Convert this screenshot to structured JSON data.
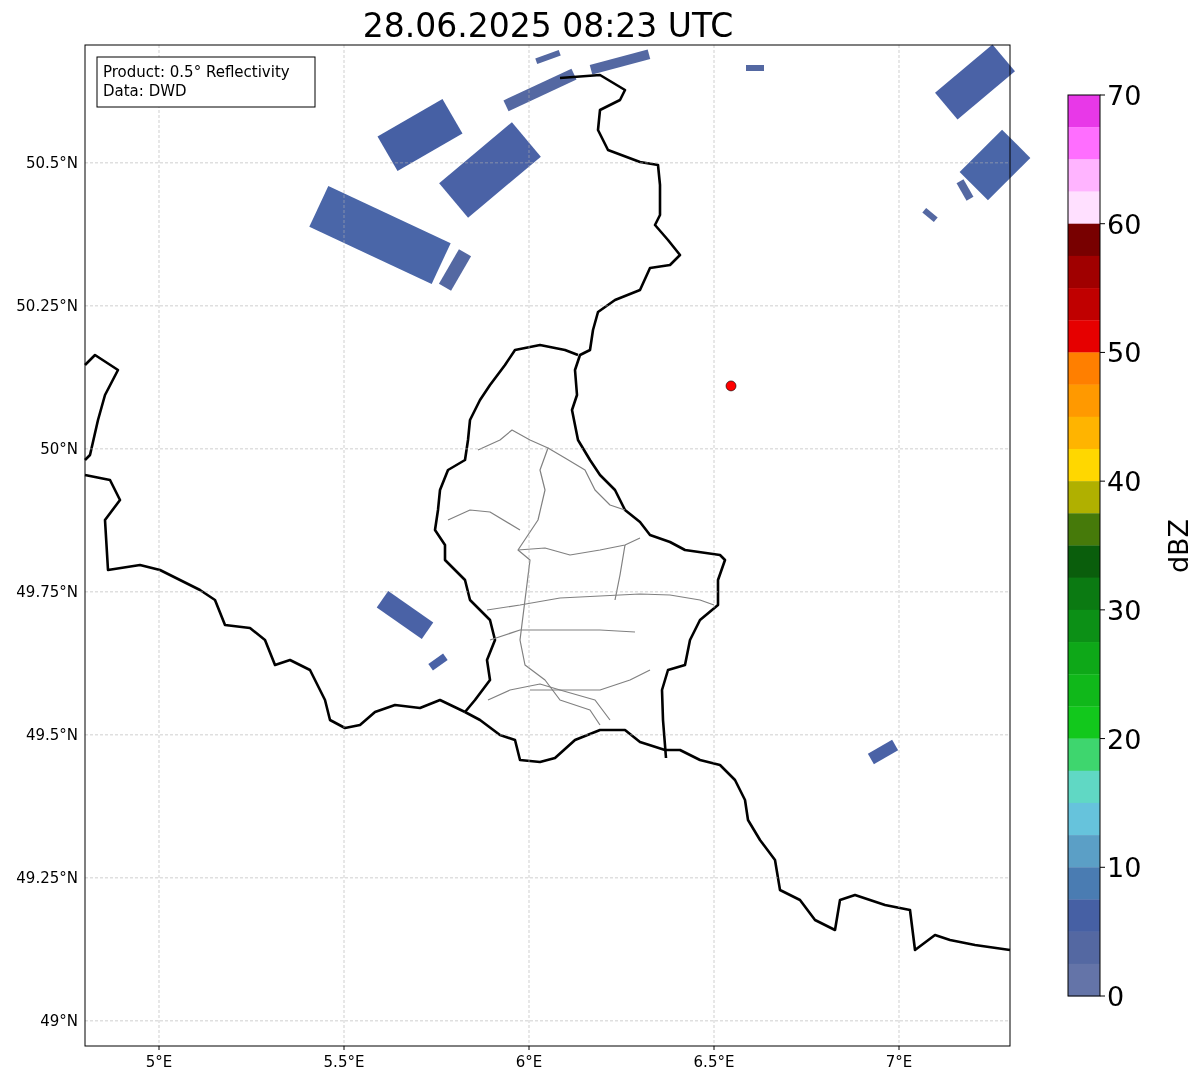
{
  "map": {
    "info_box": [
      "Product: 0.5° Reflectivity",
      "Data: DWD"
    ],
    "chart_data": {
      "type": "scatter",
      "title": "28.06.2025 08:23 UTC",
      "x": [
        6.546
      ],
      "series": [
        {
          "color": "#ff0000",
          "values": [
            50.11
          ]
        }
      ],
      "grid": true,
      "xlim": [
        4.8,
        7.3
      ],
      "ylim": [
        48.956,
        50.706
      ],
      "xticks": [
        {
          "value": 5,
          "label": "5°E"
        },
        {
          "value": 5.5,
          "label": "5.5°E"
        },
        {
          "value": 6,
          "label": "6°E"
        },
        {
          "value": 6.5,
          "label": "6.5°E"
        },
        {
          "value": 7,
          "label": "7°E"
        }
      ],
      "yticks": [
        {
          "value": 49,
          "label": "49°N"
        },
        {
          "value": 49.25,
          "label": "49.25°N"
        },
        {
          "value": 49.5,
          "label": "49.5°N"
        },
        {
          "value": 49.75,
          "label": "49.75°N"
        },
        {
          "value": 50,
          "label": "50°N"
        },
        {
          "value": 50.25,
          "label": "50.25°N"
        },
        {
          "value": 50.5,
          "label": "50.5°N"
        }
      ]
    }
  },
  "colorbar": {
    "label": "dBZ",
    "ticks": [
      "70",
      "60",
      "50",
      "40",
      "30",
      "20",
      "10",
      "0"
    ],
    "bands": [
      {
        "color": "#e838e8"
      },
      {
        "color": "#ff6eff"
      },
      {
        "color": "#ffb4ff"
      },
      {
        "color": "#ffe0ff"
      },
      {
        "color": "#780000"
      },
      {
        "color": "#a00000"
      },
      {
        "color": "#c00000"
      },
      {
        "color": "#e60000"
      },
      {
        "color": "#ff7f00"
      },
      {
        "color": "#ff9900"
      },
      {
        "color": "#ffb400"
      },
      {
        "color": "#ffd700"
      },
      {
        "color": "#b0b000"
      },
      {
        "color": "#467a0a"
      },
      {
        "color": "#0a5e0c"
      },
      {
        "color": "#0b7a12"
      },
      {
        "color": "#0c9016"
      },
      {
        "color": "#0ea818"
      },
      {
        "color": "#10b81a"
      },
      {
        "color": "#12c81c"
      },
      {
        "color": "#3ed66e"
      },
      {
        "color": "#60d8c4"
      },
      {
        "color": "#66c3dc"
      },
      {
        "color": "#5b9fc6"
      },
      {
        "color": "#4a7cb2"
      },
      {
        "color": "#4660a4"
      },
      {
        "color": "#5468a2"
      },
      {
        "color": "#6474a8"
      }
    ]
  }
}
